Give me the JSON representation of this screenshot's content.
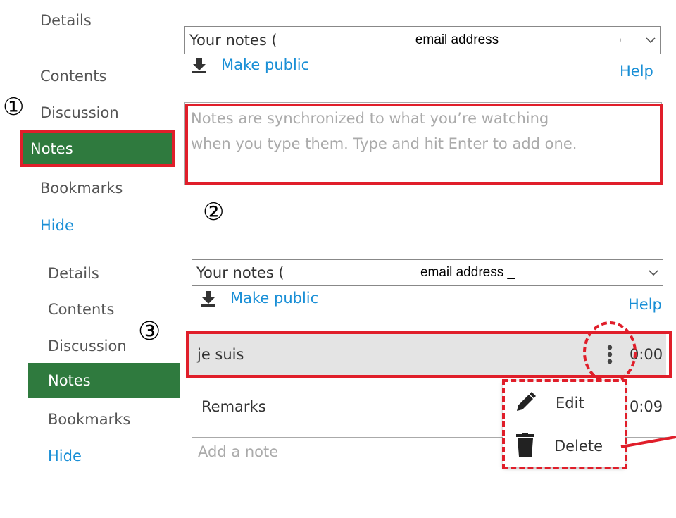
{
  "panel1": {
    "sidebar": {
      "items": [
        "Details",
        "Contents",
        "Discussion",
        "Notes",
        "Bookmarks",
        "Hide"
      ],
      "active": "Notes"
    },
    "dropdown_label": "Your notes (",
    "dropdown_close": ") ",
    "email_mask": "email address",
    "make_public": "Make public",
    "help": "Help",
    "textarea_placeholder_line1": "Notes are synchronized to what you’re watching",
    "textarea_placeholder_line2": "when you type them. Type and hit Enter to add one."
  },
  "panel2": {
    "sidebar": {
      "items": [
        "Details",
        "Contents",
        "Discussion",
        "Notes",
        "Bookmarks",
        "Hide"
      ],
      "active": "Notes"
    },
    "dropdown_label": "Your notes (",
    "dropdown_close": ") ",
    "email_mask": "email address _",
    "make_public": "Make public",
    "help": "Help",
    "notes": [
      {
        "text": "je suis",
        "time": "0:00"
      },
      {
        "text": "Remarks",
        "time": "0:09"
      }
    ],
    "add_placeholder": "Add a note",
    "menu": {
      "edit": "Edit",
      "delete": "Delete"
    }
  },
  "annotations": {
    "step1": "①",
    "step2": "②",
    "step3": "③"
  },
  "colors": {
    "active_bg": "#2f7a3e",
    "link": "#1a8fd6",
    "annotation": "#e01e2a"
  }
}
